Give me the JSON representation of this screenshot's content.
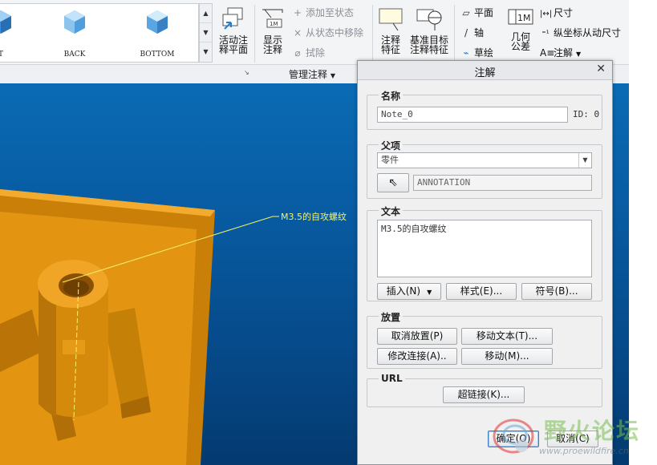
{
  "ribbon": {
    "views": [
      {
        "label": "T",
        "icon": "view-cube-icon"
      },
      {
        "label": "BACK",
        "icon": "view-cube-icon"
      },
      {
        "label": "BOTTOM",
        "icon": "view-cube-icon"
      }
    ],
    "activate_plane": "活动注\n释平面",
    "show_annotation": "显示\n注释",
    "add_to_state": "添加至状态",
    "remove_from_state": "从状态中移除",
    "erase": "拭除",
    "annotation_feature": "注释\n特征",
    "datum_target": "基准目标\n注释特征",
    "plane": "平面",
    "axis": "轴",
    "sketch": "草绘",
    "geometric_tolerance": "几何\n公差",
    "dimension": "尺寸",
    "ordinate_dimension": "纵坐标从动尺寸",
    "annotate": "注解",
    "manage_group_label": "管理注释"
  },
  "viewport": {
    "note_text": "M3.5的自攻螺纹"
  },
  "dialog": {
    "title": "注解",
    "name_section": "名称",
    "name_value": "Note_0",
    "id_label": "ID: 0",
    "parent_section": "父项",
    "parent_value": "零件",
    "parent_ref": "ANNOTATION",
    "text_section": "文本",
    "text_value": "M3.5的自攻螺纹",
    "insert_btn": "插入(N)",
    "style_btn": "样式(E)...",
    "symbol_btn": "符号(B)...",
    "placement_section": "放置",
    "cancel_place_btn": "取消放置(P)",
    "move_text_btn": "移动文本(T)...",
    "modify_attach_btn": "修改连接(A)..",
    "move_btn": "移动(M)...",
    "url_section": "URL",
    "hyperlink_btn": "超链接(K)...",
    "ok_btn": "确定(O)",
    "cancel_btn": "取消(C)"
  },
  "watermark": {
    "cn": "野火论坛",
    "url": "www.proewildfire.cn"
  },
  "colors": {
    "model": "#d98a0a",
    "note_leader": "#f4f26a",
    "viewport_top": "#0a6bb4",
    "viewport_bottom": "#043a70"
  }
}
